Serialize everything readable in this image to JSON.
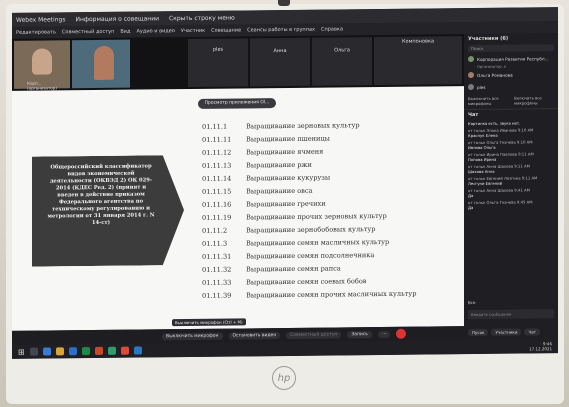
{
  "window": {
    "app_title": "Webex Meetings",
    "menu_info": "Информация о совещании",
    "hide_bar": "Скрыть строку меню"
  },
  "menu": [
    "Редактировать",
    "Совместный доступ",
    "Вид",
    "Аудио и видео",
    "Участник",
    "Совещание",
    "Сеансы работы в группах",
    "Справка"
  ],
  "video_tiles": [
    {
      "name": "Корп... (организатор)"
    },
    {
      "name": ""
    },
    {
      "name": "ples"
    },
    {
      "name": "Анна"
    },
    {
      "name": "Ольга"
    },
    {
      "name": "Компоновка"
    }
  ],
  "share": {
    "notice": "Просмотр приложения Ol...",
    "arrow_text": "Общероссийский классификатор видов экономической деятельности (ОКВЭД 2) ОК 029-2014 (КДЕС Ред. 2) (принят и введен в действие приказом Федерального агентства по техническому регулированию и метрологии от 31 января 2014 г. N 14-ст)",
    "rows": [
      {
        "code": "01.11.1",
        "desc": "Выращивание зерновых культур"
      },
      {
        "code": "01.11.11",
        "desc": "Выращивание пшеницы"
      },
      {
        "code": "01.11.12",
        "desc": "Выращивание ячменя"
      },
      {
        "code": "01.11.13",
        "desc": "Выращивание ржи"
      },
      {
        "code": "01.11.14",
        "desc": "Выращивание кукурузы"
      },
      {
        "code": "01.11.15",
        "desc": "Выращивание овса"
      },
      {
        "code": "01.11.16",
        "desc": "Выращивание гречихи"
      },
      {
        "code": "01.11.19",
        "desc": "Выращивание прочих зерновых культур"
      },
      {
        "code": "01.11.2",
        "desc": "Выращивание зернобобовых культур"
      },
      {
        "code": "01.11.3",
        "desc": "Выращивание семян масличных культур"
      },
      {
        "code": "01.11.31",
        "desc": "Выращивание семян подсолнечника"
      },
      {
        "code": "01.11.32",
        "desc": "Выращивание семян рапса"
      },
      {
        "code": "01.11.33",
        "desc": "Выращивание семян соевых бобов"
      },
      {
        "code": "01.11.39",
        "desc": "Выращивание семян прочих масличных культур"
      }
    ]
  },
  "toolbar": {
    "tooltip": "Выключить микрофон (Ctrl + M)",
    "mute": "Выключить микрофон",
    "video": "Остановить видео",
    "share": "Совместный доступ",
    "record": "Запись"
  },
  "panel": {
    "participants_header": "Участники (6)",
    "search_placeholder": "Поиск",
    "participants": [
      {
        "name": "Корпорация Развития Республ...",
        "role": "Организатор, я"
      },
      {
        "name": "Ольга Романова",
        "role": ""
      },
      {
        "name": "ples",
        "role": ""
      }
    ],
    "mute_all": "Выключить все микрофоны",
    "unmute_all": "Включить все микрофоны",
    "chat_header": "Чат",
    "chat": [
      {
        "meta": "",
        "text": "Картинка есть, звука нет."
      },
      {
        "meta": "от тольк Элана Иванова 9:10 AM",
        "text": "Краснук Елена"
      },
      {
        "meta": "от тольк Ольга Ткачева 9:10 AM",
        "text": "Ивлова Ольга"
      },
      {
        "meta": "от тольк Ирина Павлова 9:11 AM",
        "text": "Попова Ирина"
      },
      {
        "meta": "от тольк Анна Шахова 9:11 AM",
        "text": "Шахова Анна"
      },
      {
        "meta": "от тольк Евгений Лезгина 9:11 AM",
        "text": "Лесгуни Евгений"
      },
      {
        "meta": "от тольк Анна Шахова 9:41 AM",
        "text": "Да"
      },
      {
        "meta": "от тольк Ольга Ткачева 9:45 AM",
        "text": "Да"
      }
    ],
    "chat_to": "Все",
    "chat_placeholder": "Введите сообщение"
  },
  "bottom_buttons": {
    "lobby": "Пусок",
    "participants": "Участники",
    "chat": "Чат"
  },
  "clock": {
    "time": "9:46",
    "date": "17.12.2021"
  },
  "brand": "hp"
}
